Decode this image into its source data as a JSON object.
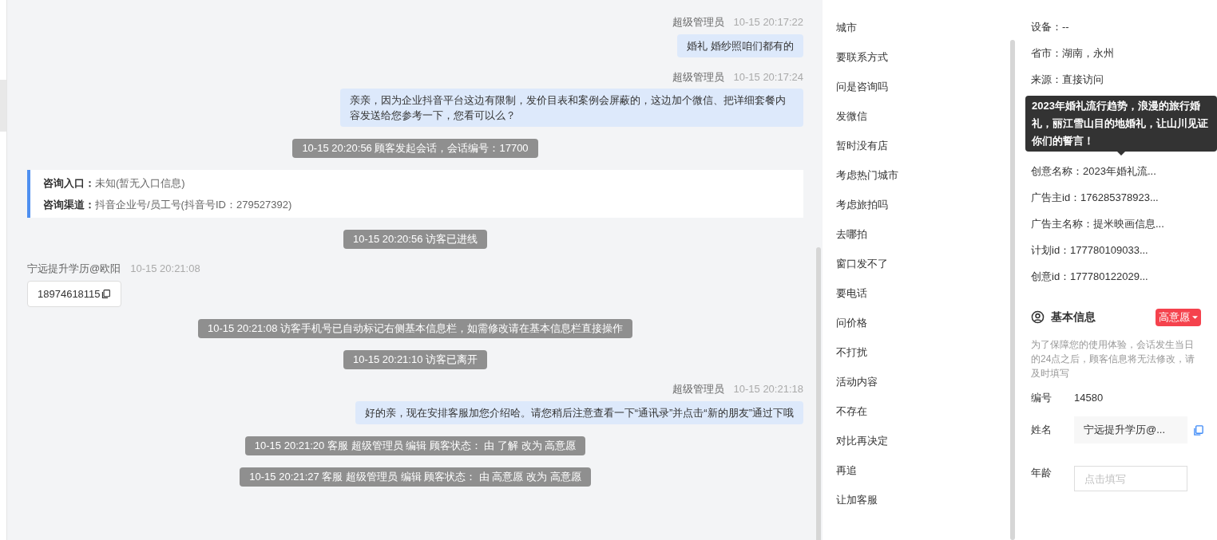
{
  "chat": {
    "messages": [
      {
        "kind": "agent",
        "sender": "超级管理员",
        "time": "10-15 20:17:22",
        "text": "婚礼 婚纱照咱们都有的"
      },
      {
        "kind": "agent",
        "sender": "超级管理员",
        "time": "10-15 20:17:24",
        "text": "亲亲，因为企业抖音平台这边有限制，发价目表和案例会屏蔽的，这边加个微信、把详细套餐内容发送给您参考一下，您看可以么？"
      },
      {
        "kind": "system",
        "text": "10-15 20:20:56 顾客发起会话，会话编号：17700"
      },
      {
        "kind": "info",
        "rows": [
          {
            "label": "咨询入口：",
            "value": "未知(暂无入口信息)"
          },
          {
            "label": "咨询渠道：",
            "value": "抖音企业号/员工号(抖音号ID：279527392)"
          }
        ]
      },
      {
        "kind": "system",
        "text": "10-15 20:20:56 访客已进线"
      },
      {
        "kind": "visitor",
        "sender": "宁远提升学历@欧阳",
        "time": "10-15 20:21:08",
        "text": "18974618115"
      },
      {
        "kind": "system",
        "text": "10-15 20:21:08 访客手机号已自动标记右侧基本信息栏，如需修改请在基本信息栏直接操作"
      },
      {
        "kind": "system",
        "text": "10-15 20:21:10 访客已离开"
      },
      {
        "kind": "agent",
        "sender": "超级管理员",
        "time": "10-15 20:21:18",
        "text": "好的亲，现在安排客服加您介绍哈。请您稍后注意查看一下“通讯录”并点击“新的朋友”通过下哦"
      },
      {
        "kind": "system",
        "text": "10-15 20:21:20 客服 超级管理员 编辑 顾客状态： 由 了解 改为 高意愿"
      },
      {
        "kind": "system",
        "text": "10-15 20:21:27 客服 超级管理员 编辑 顾客状态： 由 高意愿 改为 高意愿"
      }
    ]
  },
  "quick_replies": [
    "城市",
    "要联系方式",
    "问是咨询吗",
    "发微信",
    "暂时没有店",
    "考虑热门城市",
    "考虑旅拍吗",
    "去哪拍",
    "窗口发不了",
    "要电话",
    "问价格",
    "不打扰",
    "活动内容",
    "不存在",
    "对比再决定",
    "再追",
    "让加客服"
  ],
  "visit_info": {
    "fields_top": [
      "设备：--",
      "省市：湖南，永州",
      "来源：直接访问"
    ],
    "tooltip": "2023年婚礼流行趋势，浪漫的旅行婚礼，丽江雪山目的地婚礼，让山川见证你们的誓言！",
    "fields_bottom": [
      "创意名称：2023年婚礼流...",
      "广告主id：176285378923...",
      "广告主名称：提米映画信息...",
      "计划id：177780109033...",
      "创意id：177780122029..."
    ]
  },
  "basic_info": {
    "title": "基本信息",
    "status": "高意愿",
    "hint": "为了保障您的使用体验，会话发生当日的24点之后，顾客信息将无法修改，请及时填写",
    "fields": [
      {
        "kind": "text",
        "label": "编号",
        "value": "14580"
      },
      {
        "kind": "filled",
        "label": "姓名",
        "value": "宁远提升学历@..."
      },
      {
        "kind": "input",
        "label": "年龄",
        "placeholder": "点击填写"
      }
    ]
  }
}
